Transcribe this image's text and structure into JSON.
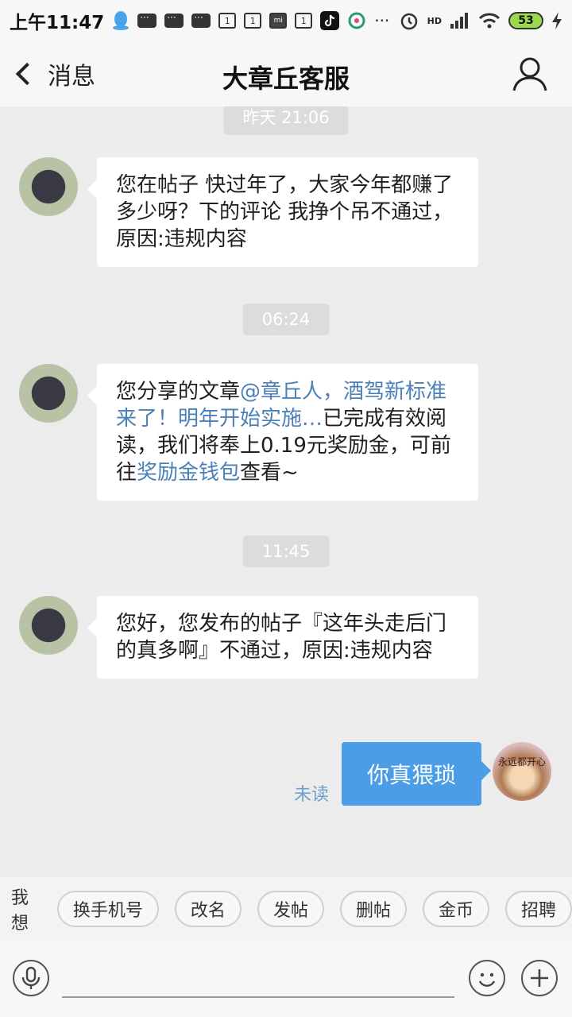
{
  "status_bar": {
    "time": "上午11:47",
    "notif_box_label": "1",
    "mi_label": "mi",
    "hd_label": "HD",
    "battery": "53"
  },
  "header": {
    "back_label": "消息",
    "title": "大章丘客服"
  },
  "messages": {
    "time1": "昨天 21:06",
    "msg1": "您在帖子 快过年了，大家今年都赚了多少呀？下的评论 我挣个吊不通过，原因:违规内容",
    "time2": "06:24",
    "msg2_prefix": "您分享的文章",
    "msg2_link1": "@章丘人，酒驾新标准来了！明年开始实施…",
    "msg2_mid": "已完成有效阅读，我们将奉上0.19元奖励金，可前往",
    "msg2_link2": "奖励金钱包",
    "msg2_suffix": "查看~",
    "time3": "11:45",
    "msg3": "您好，您发布的帖子『这年头走后门的真多啊』不通过，原因:违规内容",
    "outgoing": "你真猥琐",
    "unread_label": "未读",
    "self_avatar_text": "永远都开心"
  },
  "quick_bar": {
    "label": "我想",
    "chips": [
      "换手机号",
      "改名",
      "发帖",
      "删帖",
      "金币",
      "招聘"
    ]
  },
  "input_bar": {
    "placeholder": ""
  },
  "colors": {
    "accent_blue": "#4a9de6",
    "link_blue": "#4a7fb8",
    "background": "#ececec"
  }
}
